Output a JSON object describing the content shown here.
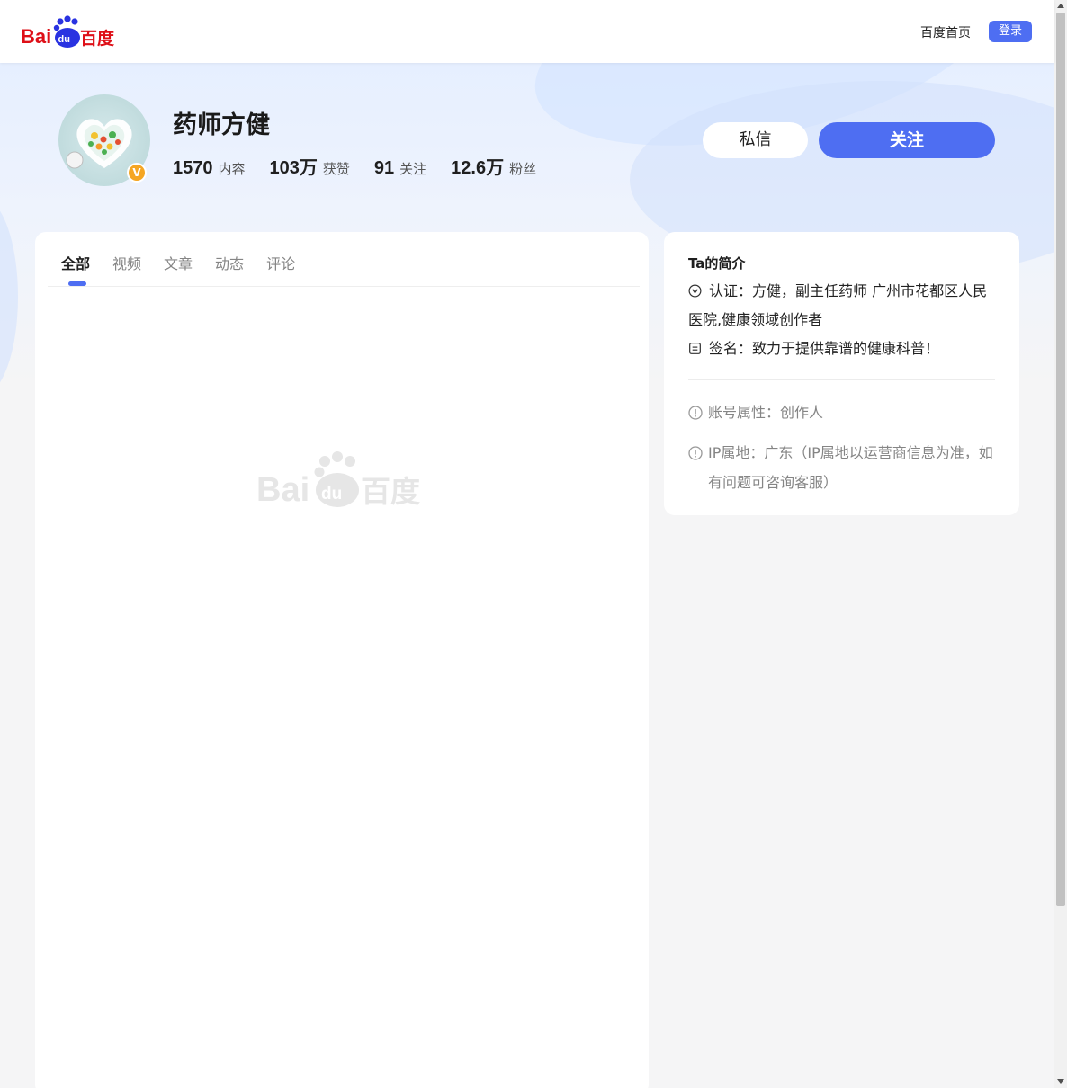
{
  "header": {
    "logo_text": "Bai百度",
    "home_link": "百度首页",
    "login_button": "登录"
  },
  "profile": {
    "name": "药师方健",
    "verified_badge": "V",
    "stats": [
      {
        "value": "1570",
        "label": "内容"
      },
      {
        "value": "103万",
        "label": "获赞"
      },
      {
        "value": "91",
        "label": "关注"
      },
      {
        "value": "12.6万",
        "label": "粉丝"
      }
    ],
    "message_button": "私信",
    "follow_button": "关注"
  },
  "tabs": [
    {
      "label": "全部",
      "active": true
    },
    {
      "label": "视频",
      "active": false
    },
    {
      "label": "文章",
      "active": false
    },
    {
      "label": "动态",
      "active": false
    },
    {
      "label": "评论",
      "active": false
    }
  ],
  "sidebar": {
    "title": "Ta的简介",
    "certification": "认证：方健，副主任药师 广州市花都区人民医院,健康领域创作者",
    "signature": "签名：致力于提供靠谱的健康科普！",
    "account_type": "账号属性：创作人",
    "ip_location": "IP属地：广东（IP属地以运营商信息为准，如有问题可咨询客服）"
  },
  "colors": {
    "accent": "#4e6ef2",
    "badge": "#f5a623",
    "logo_red": "#de0f17",
    "logo_blue": "#2932e1"
  }
}
